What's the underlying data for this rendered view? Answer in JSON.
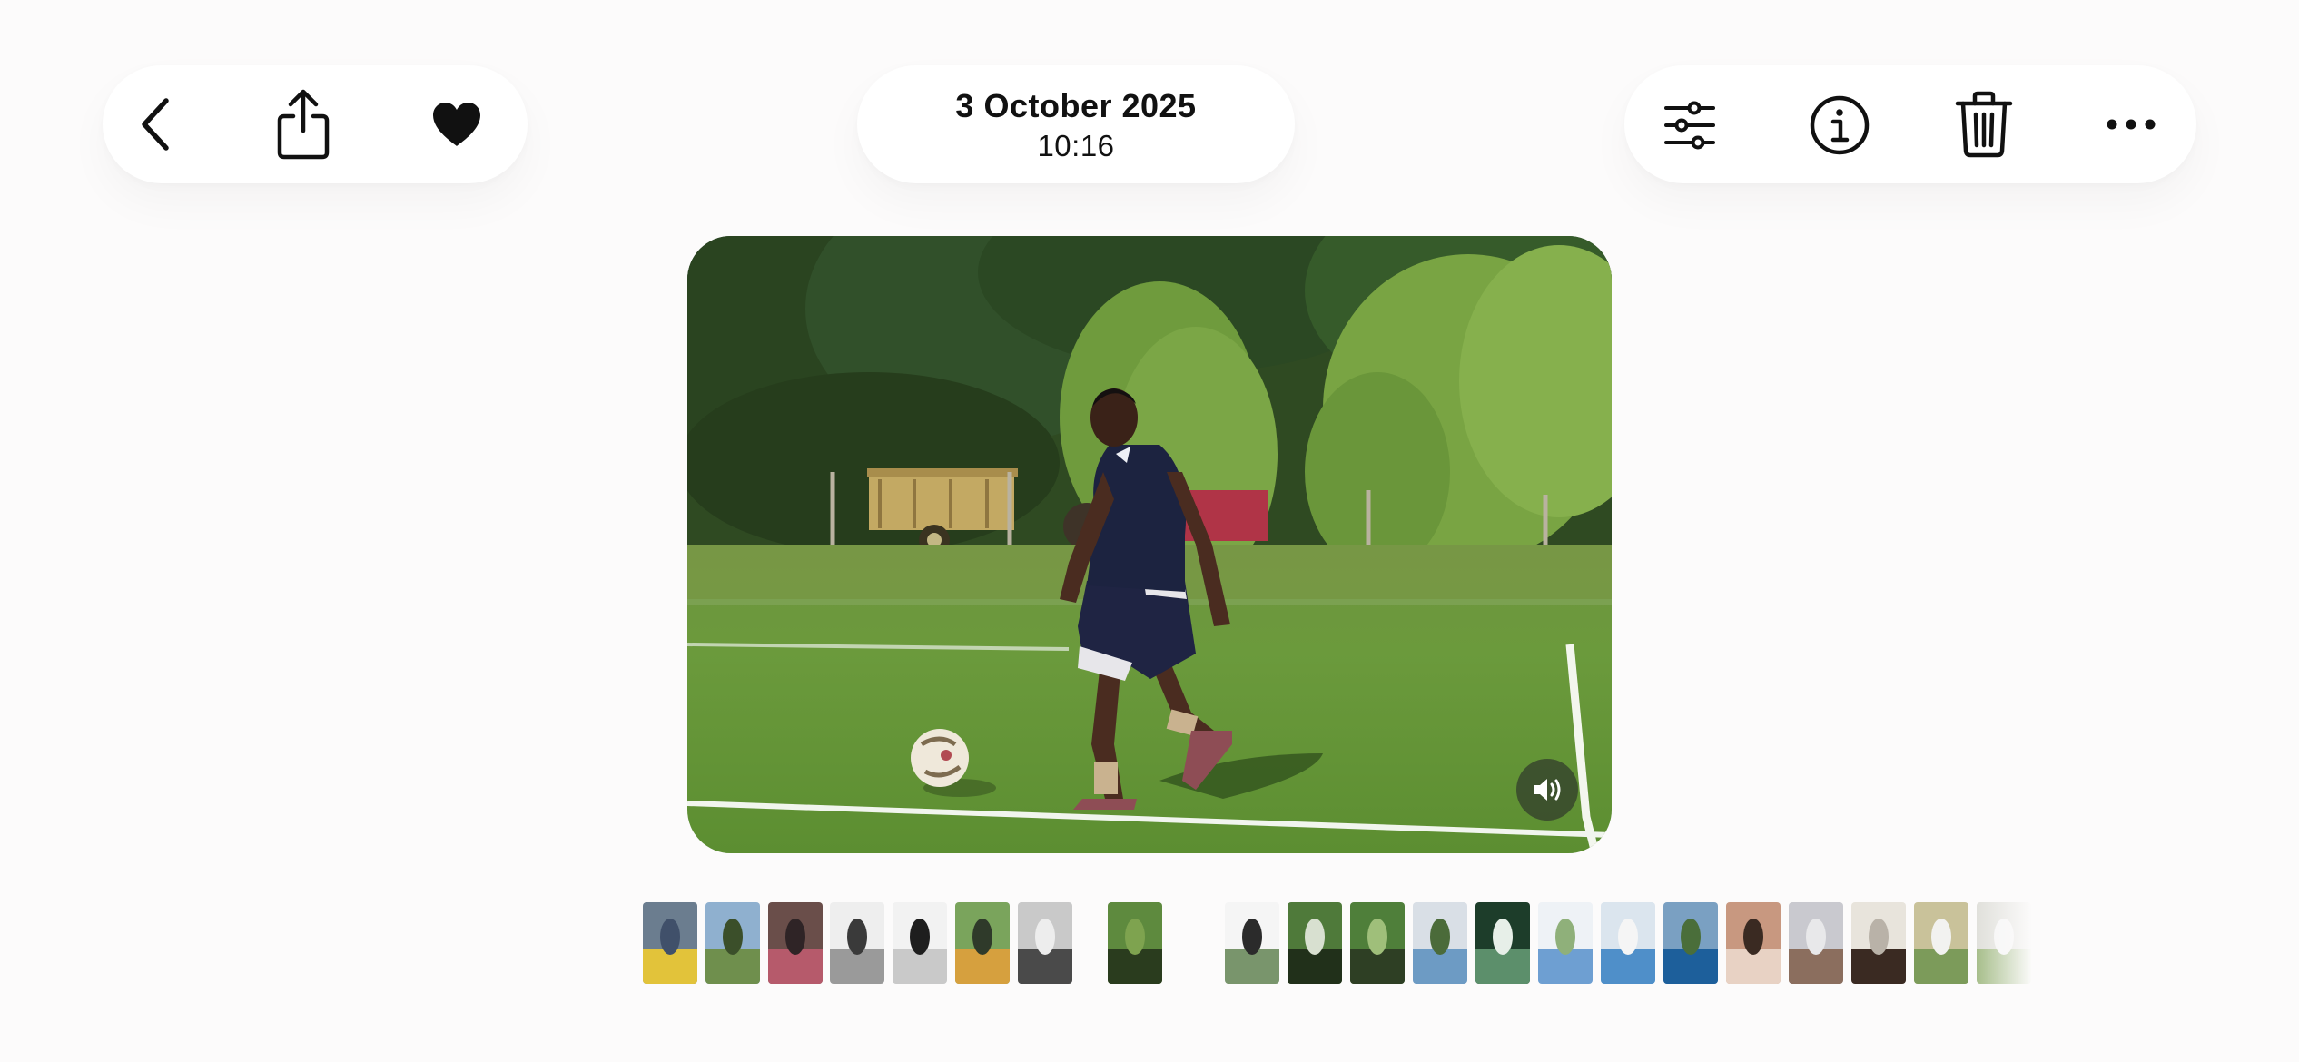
{
  "header": {
    "date": "3 October 2025",
    "time": "10:16"
  },
  "left_actions": [
    {
      "name": "back-icon"
    },
    {
      "name": "share-icon"
    },
    {
      "name": "heart-filled-icon"
    }
  ],
  "right_actions": [
    {
      "name": "adjustments-sliders-icon"
    },
    {
      "name": "info-circle-icon"
    },
    {
      "name": "trash-icon"
    },
    {
      "name": "more-ellipsis-icon"
    }
  ],
  "media": {
    "type": "video",
    "audio_icon": "speaker-icon"
  },
  "filmstrip": {
    "thumbnail_count": 23,
    "selected_index": 7
  },
  "colors": {
    "background": "#fcfbfb",
    "pill": "#ffffff",
    "icon": "#111111"
  }
}
